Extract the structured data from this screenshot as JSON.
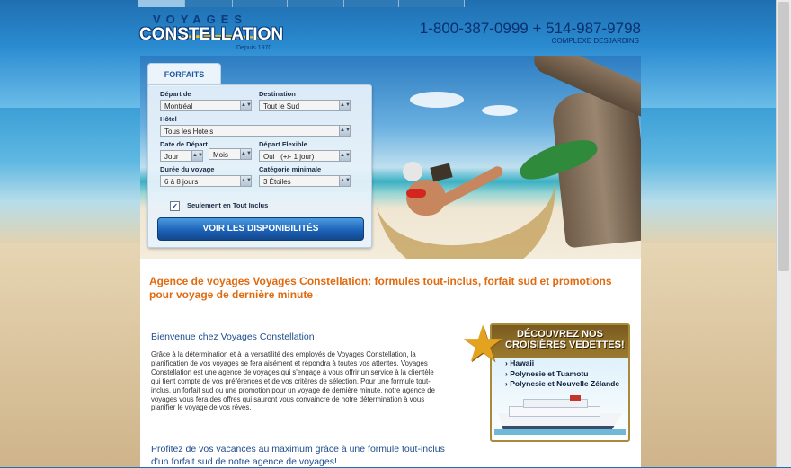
{
  "nav": {
    "tabs": [
      "",
      "",
      "",
      "",
      "",
      ""
    ]
  },
  "logo": {
    "line1": "VOYAGES",
    "line2": "CONSTELLATION",
    "since": "Depuis 1970"
  },
  "contact": {
    "phone": "1-800-387-0999 + 514-987-9798",
    "branch": "COMPLEXE DESJARDINS"
  },
  "booking": {
    "tab": "FORFAITS",
    "depart_label": "Départ de",
    "depart_value": "Montréal",
    "destination_label": "Destination",
    "destination_value": "Tout le Sud",
    "hotel_label": "Hôtel",
    "hotel_value": "Tous les Hotels",
    "date_label": "Date de Départ",
    "day_value": "Jour",
    "month_value": "Mois",
    "flex_label": "Départ Flexible",
    "flex_value": "Oui   (+/- 1 jour)",
    "duration_label": "Durée du voyage",
    "duration_value": "6 à 8 jours",
    "category_label": "Catégorie minimale",
    "category_value": "3 Étoiles",
    "all_inclusive_label": "Seulement en Tout Inclus",
    "all_inclusive_checked": "✔",
    "submit": "VOIR LES DISPONIBILITÉS"
  },
  "content": {
    "headline": "Agence de voyages Voyages Constellation: formules tout-inclus, forfait sud et promotions pour voyage de dernière minute",
    "welcome": "Bienvenue chez Voyages Constellation",
    "paragraph": "Grâce à la détermination et à la versatilité des employés de Voyages Constellation, la planification de vos voyages se fera aisément et répondra à toutes vos attentes. Voyages Constellation est une agence de voyages qui s'engage à vous offrir un service à la clientèle qui tient compte de vos préférences et de vos critères de sélection. Pour une formule tout-inclus, un forfait sud ou une promotion pour un voyage de dernière minute, notre agence de voyages vous fera des offres qui sauront vous convaincre de notre détermination à vous planifier le voyage de vos rêves.",
    "subheading": "Profitez de vos vacances au maximum grâce à une formule tout-inclus d'un forfait sud de notre agence de voyages!"
  },
  "promo": {
    "title1": "DÉCOUVREZ NOS",
    "title2": "CROISIÈRES VEDETTES!",
    "items": [
      "Hawaii",
      "Polynesie et Tuamotu",
      "Polynesie et Nouvelle Zélande"
    ]
  }
}
